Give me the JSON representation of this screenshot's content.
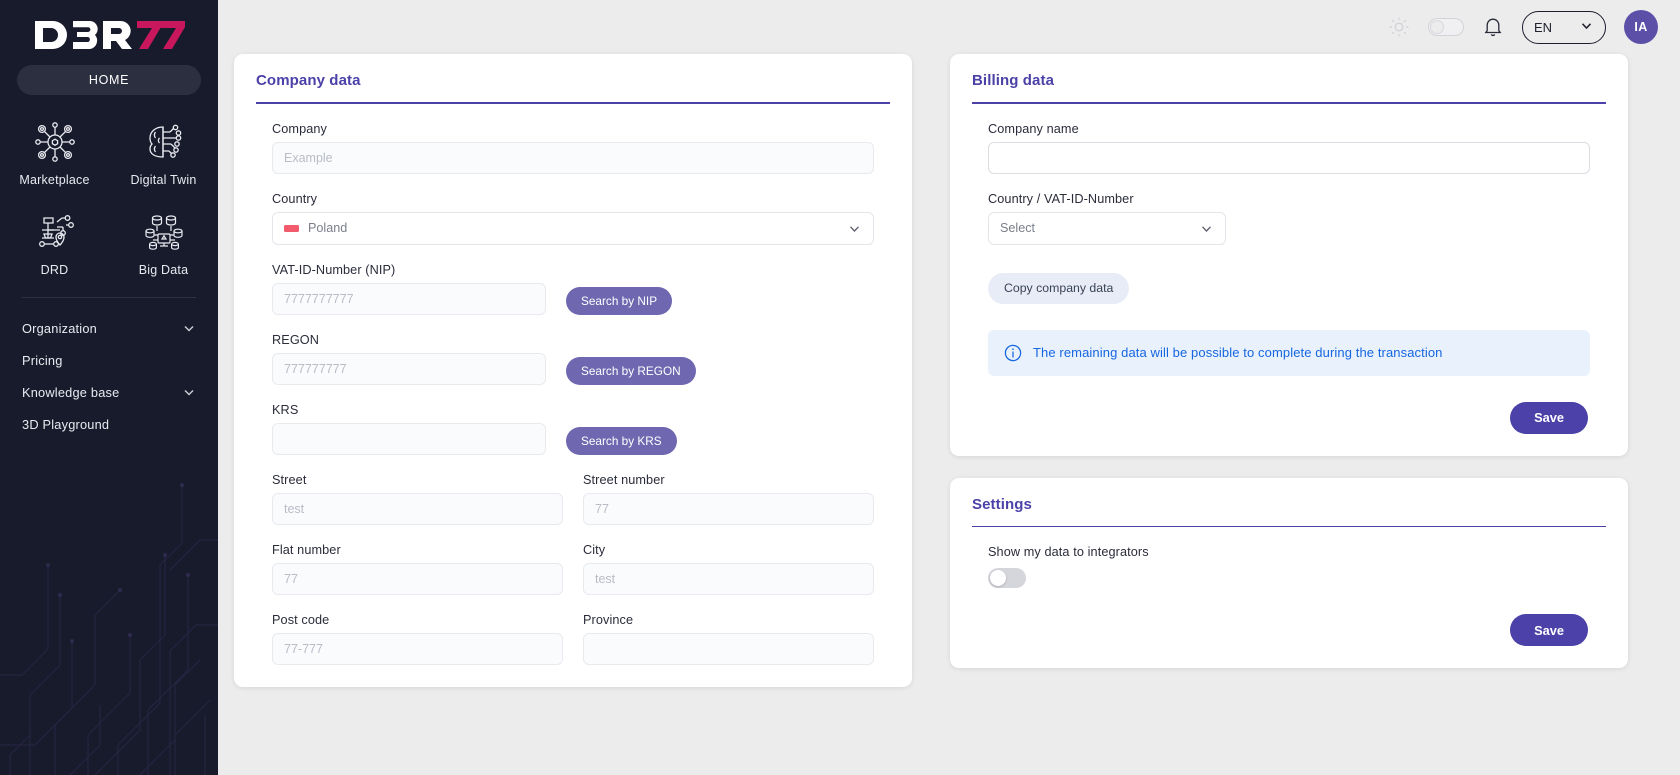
{
  "sidebar": {
    "logo_text": "DBR77",
    "home_label": "HOME",
    "tiles": [
      {
        "label": "Marketplace",
        "icon": "marketplace-icon"
      },
      {
        "label": "Digital Twin",
        "icon": "digital-twin-icon"
      },
      {
        "label": "DRD",
        "icon": "drd-icon"
      },
      {
        "label": "Big Data",
        "icon": "big-data-icon"
      }
    ],
    "nav": [
      {
        "label": "Organization",
        "expandable": true
      },
      {
        "label": "Pricing",
        "expandable": false
      },
      {
        "label": "Knowledge base",
        "expandable": true
      },
      {
        "label": "3D Playground",
        "expandable": false
      }
    ]
  },
  "topbar": {
    "theme_icon": "sun-icon",
    "notifications_icon": "bell-icon",
    "language": "EN",
    "avatar_initials": "IA"
  },
  "company_card": {
    "title": "Company data",
    "company": {
      "label": "Company",
      "value": "",
      "placeholder": "Example"
    },
    "country": {
      "label": "Country",
      "value": "Poland",
      "flag": "pl-flag-icon"
    },
    "nip": {
      "label": "VAT-ID-Number (NIP)",
      "value": "",
      "placeholder": "7777777777",
      "button": "Search by NIP"
    },
    "regon": {
      "label": "REGON",
      "value": "",
      "placeholder": "777777777",
      "button": "Search by REGON"
    },
    "krs": {
      "label": "KRS",
      "value": "",
      "placeholder": "",
      "button": "Search by KRS"
    },
    "street": {
      "label": "Street",
      "value": "",
      "placeholder": "test"
    },
    "street_number": {
      "label": "Street number",
      "value": "",
      "placeholder": "77"
    },
    "flat_number": {
      "label": "Flat number",
      "value": "",
      "placeholder": "77"
    },
    "city": {
      "label": "City",
      "value": "",
      "placeholder": "test"
    },
    "post_code": {
      "label": "Post code",
      "value": "",
      "placeholder": "77-777"
    },
    "province": {
      "label": "Province",
      "value": "",
      "placeholder": ""
    }
  },
  "billing_card": {
    "title": "Billing data",
    "company_name": {
      "label": "Company name",
      "value": "",
      "placeholder": ""
    },
    "country_vat": {
      "label": "Country / VAT-ID-Number",
      "value": "Select"
    },
    "copy_button": "Copy company data",
    "info": "The remaining data will be possible to complete during the transaction",
    "save_button": "Save"
  },
  "settings_card": {
    "title": "Settings",
    "toggle_label": "Show my data to integrators",
    "toggle_on": false,
    "save_button": "Save"
  },
  "colors": {
    "accent": "#4b41a8",
    "button": "#6f68b0",
    "info_text": "#1667e0",
    "info_bg": "#e9f1fd",
    "sidebar_bg": "#181b2c",
    "avatar_bg": "#5b4fa8",
    "logo_accent": "#c8175c"
  }
}
